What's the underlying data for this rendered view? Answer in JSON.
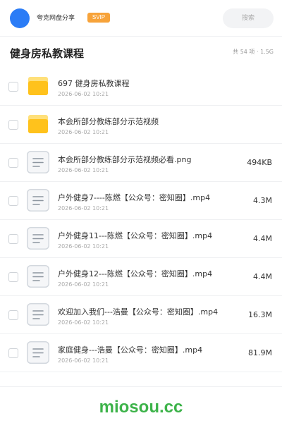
{
  "header": {
    "share_label": "夸克网盘分享",
    "badge": "SVIP",
    "search_placeholder": "搜索"
  },
  "folder": {
    "title": "健身房私教课程",
    "summary": "共 54 项 · 1.5G"
  },
  "files": [
    {
      "icon": "folder-icon",
      "name": "697 健身房私教课程",
      "date": "2026-06-02 10:21"
    },
    {
      "icon": "folder-icon",
      "name": "本会所部分教练部分示范视频",
      "date": "2026-06-02 10:21"
    },
    {
      "icon": "document-icon",
      "name": "本会所部分教练部分示范视频必看.png",
      "date": "2026-06-02 10:21",
      "size": "494KB"
    },
    {
      "icon": "document-icon",
      "name": "户外健身7----陈燃【公众号：密知圈】.mp4",
      "date": "2026-06-02 10:21",
      "size": "4.3M"
    },
    {
      "icon": "document-icon",
      "name": "户外健身11---陈燃【公众号：密知圈】.mp4",
      "date": "2026-06-02 10:21",
      "size": "4.4M"
    },
    {
      "icon": "document-icon",
      "name": "户外健身12---陈燃【公众号：密知圈】.mp4",
      "date": "2026-06-02 10:21",
      "size": "4.4M"
    },
    {
      "icon": "document-icon",
      "name": "欢迎加入我们---浩曼【公众号：密知圈】.mp4",
      "date": "2026-06-02 10:21",
      "size": "16.3M"
    },
    {
      "icon": "document-icon",
      "name": "家庭健身---浩曼【公众号：密知圈】.mp4",
      "date": "2026-06-02 10:21",
      "size": "81.9M"
    }
  ],
  "footer": {
    "watermark": "miosou.cc"
  },
  "colors": {
    "accent": "#2b7cf6",
    "badge": "#f7a33a",
    "folder": "#ffc21c",
    "folder_tab": "#ffe07a",
    "watermark": "#3db34a"
  }
}
